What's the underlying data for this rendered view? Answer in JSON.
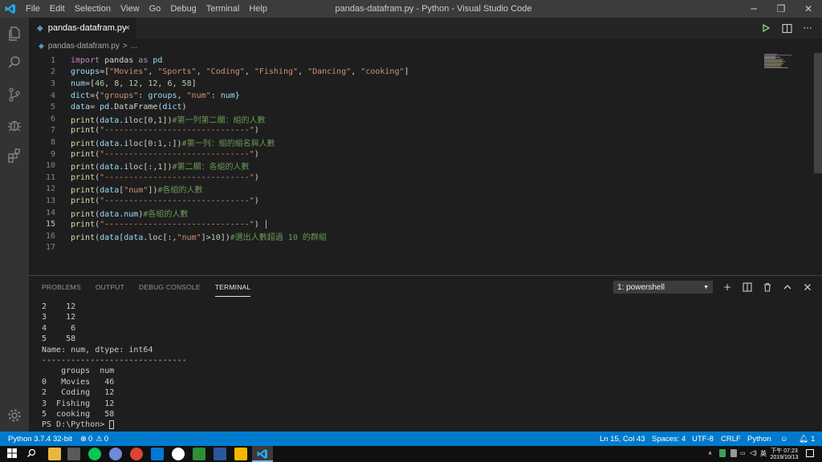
{
  "titlebar": {
    "menu": [
      "File",
      "Edit",
      "Selection",
      "View",
      "Go",
      "Debug",
      "Terminal",
      "Help"
    ],
    "window_title": "pandas-datafram.py - Python - Visual Studio Code",
    "controls": [
      "─",
      "❐",
      "✕"
    ]
  },
  "tab": {
    "label": "pandas-datafram.py",
    "close": "×"
  },
  "breadcrumb": {
    "file": "pandas-datafram.py",
    "sep": ">",
    "more": "..."
  },
  "editor": {
    "active_line": 15,
    "lines": [
      {
        "n": "1",
        "text": "import pandas as pd"
      },
      {
        "n": "2",
        "text": "groups=[\"Movies\", \"Sports\", \"Coding\", \"Fishing\", \"Dancing\", \"cooking\"]"
      },
      {
        "n": "3",
        "text": "num=[46, 8, 12, 12, 6, 58]"
      },
      {
        "n": "4",
        "text": "dict={\"groups\": groups, \"num\": num}"
      },
      {
        "n": "5",
        "text": "data= pd.DataFrame(dict)"
      },
      {
        "n": "6",
        "text": "print(data.iloc[0,1])#第一列第二欄：組的人數"
      },
      {
        "n": "7",
        "text": "print(\"------------------------------\")"
      },
      {
        "n": "8",
        "text": "print(data.iloc[0:1,:])#第一列：組的組名與人數"
      },
      {
        "n": "9",
        "text": "print(\"------------------------------\")"
      },
      {
        "n": "10",
        "text": "print(data.iloc[:,1])#第二欄：各組的人數"
      },
      {
        "n": "11",
        "text": "print(\"------------------------------\")"
      },
      {
        "n": "12",
        "text": "print(data[\"num\"])#各組的人數"
      },
      {
        "n": "13",
        "text": "print(\"------------------------------\")"
      },
      {
        "n": "14",
        "text": "print(data.num)#各組的人數"
      },
      {
        "n": "15",
        "text": "print(\"------------------------------\")"
      },
      {
        "n": "16",
        "text": "print(data[data.loc[:,\"num\"]>10])#選出人數超過 10 的群組"
      },
      {
        "n": "17",
        "text": ""
      }
    ]
  },
  "panel": {
    "tabs": [
      "PROBLEMS",
      "OUTPUT",
      "DEBUG CONSOLE",
      "TERMINAL"
    ],
    "active_tab": "TERMINAL",
    "terminal_select": "1: powershell",
    "actions": [
      "+",
      "◫",
      "🗑",
      "∧",
      "×"
    ],
    "terminal_lines": [
      "2    12",
      "3    12",
      "4     6",
      "5    58",
      "Name: num, dtype: int64",
      "------------------------------",
      "    groups  num",
      "0   Movies   46",
      "2   Coding   12",
      "3  Fishing   12",
      "5  cooking   58",
      "PS D:\\Python> "
    ]
  },
  "statusbar": {
    "interpreter": "Python 3.7.4 32-bit",
    "errors": "0",
    "warnings": "0",
    "position": "Ln 15, Col 43",
    "spaces": "Spaces: 4",
    "encoding": "UTF-8",
    "eol": "CRLF",
    "language": "Python",
    "notifications": "1"
  },
  "taskbar": {
    "time_period": "下午 07:23",
    "date": "2019/10/13",
    "ime": "英"
  },
  "colors": {
    "statusbar": "#007acc",
    "keyword": "#c586c0",
    "string": "#ce9178",
    "number": "#b5cea8",
    "comment": "#6a9955"
  }
}
